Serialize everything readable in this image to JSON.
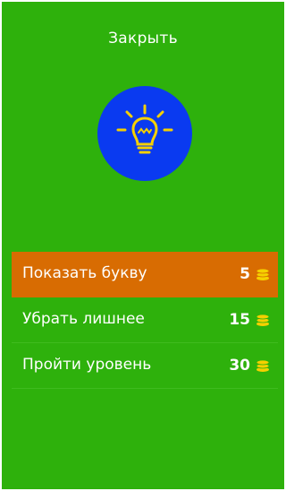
{
  "header": {
    "close_label": "Закрыть"
  },
  "hint_icon": {
    "name": "lightbulb-icon",
    "circle_color": "#0a3af0",
    "icon_color": "#f5d000"
  },
  "menu": {
    "items": [
      {
        "label": "Показать букву",
        "price": "5",
        "icon": "coins-icon",
        "highlighted": true
      },
      {
        "label": "Убрать лишнее",
        "price": "15",
        "icon": "coins-icon",
        "highlighted": false
      },
      {
        "label": "Пройти уровень",
        "price": "30",
        "icon": "coins-icon",
        "highlighted": false
      }
    ]
  },
  "colors": {
    "background": "#2eb10c",
    "highlight": "#d86c02",
    "coin": "#f5d000"
  }
}
